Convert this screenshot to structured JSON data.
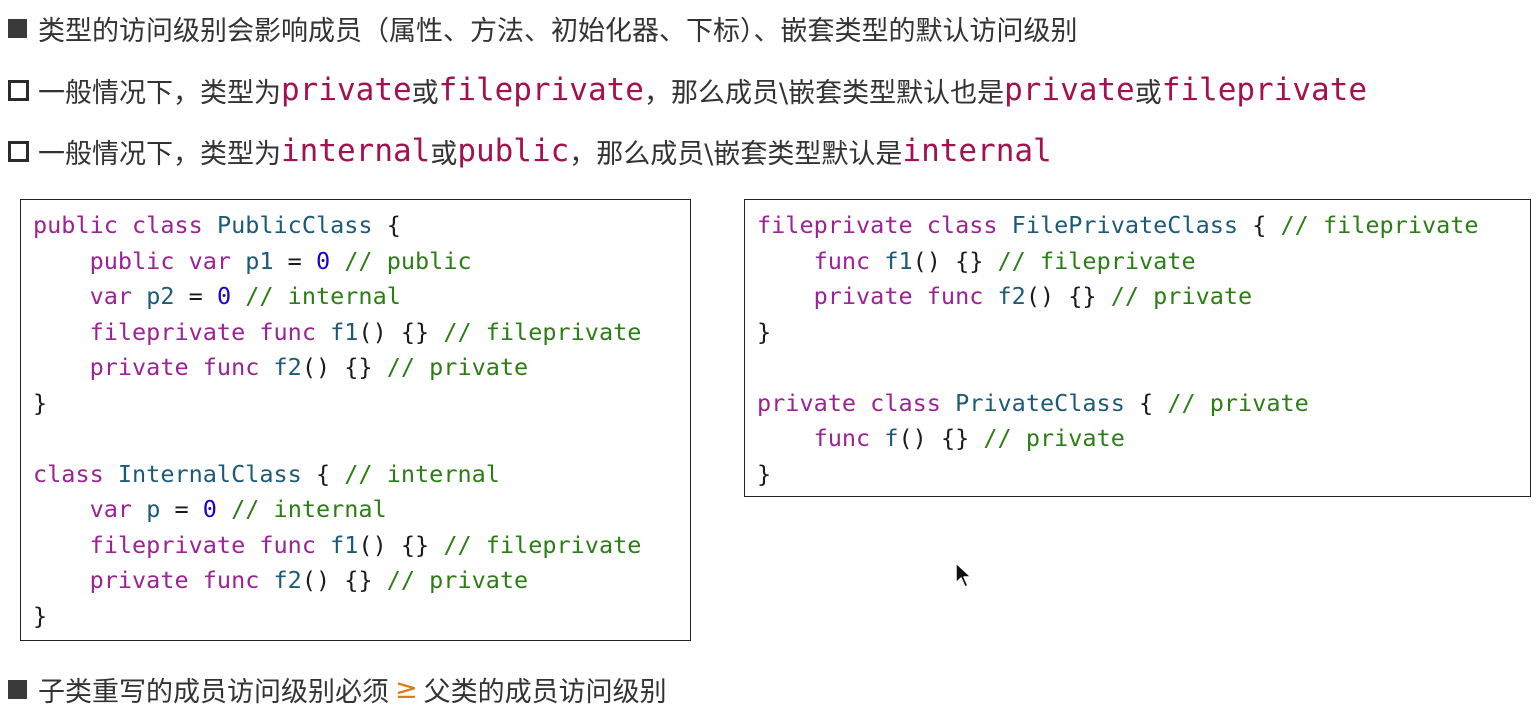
{
  "bullets": {
    "b1": "类型的访问级别会影响成员（属性、方法、初始化器、下标）、嵌套类型的默认访问级别",
    "b2": {
      "p1": "一般情况下，类型为",
      "k1": "private",
      "p2": "或",
      "k2": "fileprivate",
      "p3": "，那么成员\\嵌套类型默认也是",
      "k3": "private",
      "p4": "或",
      "k4": "fileprivate"
    },
    "b3": {
      "p1": "一般情况下，类型为",
      "k1": "internal",
      "p2": "或",
      "k2": "public",
      "p3": "，那么成员\\嵌套类型默认是",
      "k3": "internal"
    },
    "b4": {
      "p1": "子类重写的成员访问级别必须",
      "ge": "≥",
      "p2": "父类的成员访问级别"
    }
  },
  "code_left": [
    [
      {
        "t": "public class ",
        "c": "k"
      },
      {
        "t": "PublicClass",
        "c": "t"
      },
      {
        "t": " {",
        "c": "p"
      }
    ],
    [
      {
        "t": "    public var ",
        "c": "k"
      },
      {
        "t": "p1",
        "c": "t"
      },
      {
        "t": " = ",
        "c": "p"
      },
      {
        "t": "0",
        "c": "n"
      },
      {
        "t": " // public",
        "c": "c"
      }
    ],
    [
      {
        "t": "    var ",
        "c": "k"
      },
      {
        "t": "p2",
        "c": "t"
      },
      {
        "t": " = ",
        "c": "p"
      },
      {
        "t": "0",
        "c": "n"
      },
      {
        "t": " // internal",
        "c": "c"
      }
    ],
    [
      {
        "t": "    fileprivate func ",
        "c": "k"
      },
      {
        "t": "f1",
        "c": "t"
      },
      {
        "t": "() {} ",
        "c": "p"
      },
      {
        "t": "// fileprivate",
        "c": "c"
      }
    ],
    [
      {
        "t": "    private func ",
        "c": "k"
      },
      {
        "t": "f2",
        "c": "t"
      },
      {
        "t": "() {} ",
        "c": "p"
      },
      {
        "t": "// private",
        "c": "c"
      }
    ],
    [
      {
        "t": "}",
        "c": "p"
      }
    ],
    [
      {
        "t": " ",
        "c": "p"
      }
    ],
    [
      {
        "t": "class ",
        "c": "k"
      },
      {
        "t": "InternalClass",
        "c": "t"
      },
      {
        "t": " { ",
        "c": "p"
      },
      {
        "t": "// internal",
        "c": "c"
      }
    ],
    [
      {
        "t": "    var ",
        "c": "k"
      },
      {
        "t": "p",
        "c": "t"
      },
      {
        "t": " = ",
        "c": "p"
      },
      {
        "t": "0",
        "c": "n"
      },
      {
        "t": " // internal",
        "c": "c"
      }
    ],
    [
      {
        "t": "    fileprivate func ",
        "c": "k"
      },
      {
        "t": "f1",
        "c": "t"
      },
      {
        "t": "() {} ",
        "c": "p"
      },
      {
        "t": "// fileprivate",
        "c": "c"
      }
    ],
    [
      {
        "t": "    private func ",
        "c": "k"
      },
      {
        "t": "f2",
        "c": "t"
      },
      {
        "t": "() {} ",
        "c": "p"
      },
      {
        "t": "// private",
        "c": "c"
      }
    ],
    [
      {
        "t": "}",
        "c": "p"
      }
    ]
  ],
  "code_right": [
    [
      {
        "t": "fileprivate class ",
        "c": "k"
      },
      {
        "t": "FilePrivateClass",
        "c": "t"
      },
      {
        "t": " { ",
        "c": "p"
      },
      {
        "t": "// fileprivate",
        "c": "c"
      }
    ],
    [
      {
        "t": "    func ",
        "c": "k"
      },
      {
        "t": "f1",
        "c": "t"
      },
      {
        "t": "() {} ",
        "c": "p"
      },
      {
        "t": "// fileprivate",
        "c": "c"
      }
    ],
    [
      {
        "t": "    private func ",
        "c": "k"
      },
      {
        "t": "f2",
        "c": "t"
      },
      {
        "t": "() {} ",
        "c": "p"
      },
      {
        "t": "// private",
        "c": "c"
      }
    ],
    [
      {
        "t": "}",
        "c": "p"
      }
    ],
    [
      {
        "t": " ",
        "c": "p"
      }
    ],
    [
      {
        "t": "private class ",
        "c": "k"
      },
      {
        "t": "PrivateClass",
        "c": "t"
      },
      {
        "t": " { ",
        "c": "p"
      },
      {
        "t": "// private",
        "c": "c"
      }
    ],
    [
      {
        "t": "    func ",
        "c": "k"
      },
      {
        "t": "f",
        "c": "t"
      },
      {
        "t": "() {} ",
        "c": "p"
      },
      {
        "t": "// private",
        "c": "c"
      }
    ],
    [
      {
        "t": "}",
        "c": "p"
      }
    ]
  ],
  "colors": {
    "keyword_highlight": "#a3124f",
    "ge_symbol": "#e07a17",
    "code_keyword": "#9b2393",
    "code_type": "#1c5a78",
    "code_comment": "#2d7d17",
    "code_number": "#1c00cf"
  },
  "icons": {
    "bullet_filled": "filled-square",
    "bullet_hollow": "hollow-square",
    "cursor": "mouse-pointer-arrow"
  }
}
